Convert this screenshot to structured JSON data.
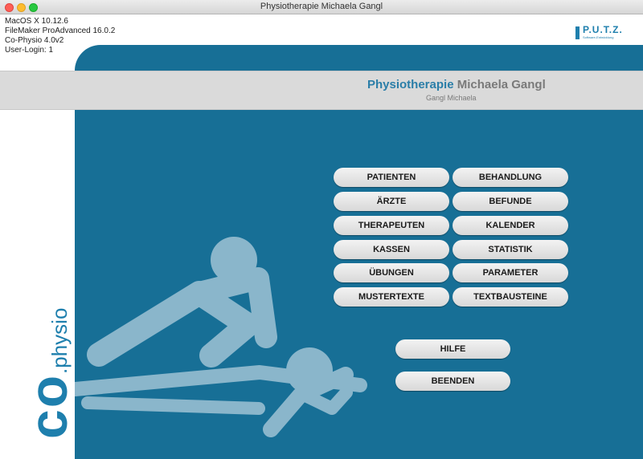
{
  "window": {
    "title": "Physiotherapie Michaela Gangl"
  },
  "sysinfo": [
    "MacOS X 10.12.6",
    "FileMaker ProAdvanced 16.0.2",
    "Co-Physio 4.0v2",
    "User-Login: 1"
  ],
  "logo": {
    "word": "P.U.T.Z.",
    "subtitle": "Software-Entwicklung"
  },
  "header": {
    "title_part1": "Physiotherapie",
    "title_part2": "Michaela Gangl",
    "user": "Gangl Michaela"
  },
  "brand": {
    "co": "co",
    "physio": ".physio"
  },
  "menu": {
    "left": [
      "PATIENTEN",
      "ÄRZTE",
      "THERAPEUTEN",
      "KASSEN",
      "ÜBUNGEN",
      "MUSTERTEXTE"
    ],
    "right": [
      "BEHANDLUNG",
      "BEFUNDE",
      "KALENDER",
      "STATISTIK",
      "PARAMETER",
      "TEXTBAUSTEINE"
    ]
  },
  "actions": {
    "help": "HILFE",
    "quit": "BEENDEN"
  },
  "colors": {
    "primary": "#176f96",
    "accent": "#2b7ea8",
    "band": "#dadada",
    "figure": "#8ab6cb"
  }
}
